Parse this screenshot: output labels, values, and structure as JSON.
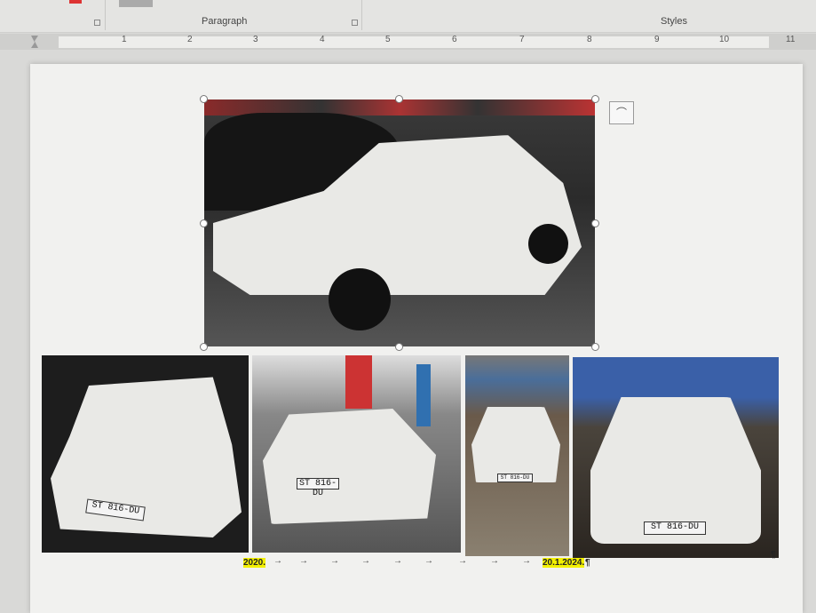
{
  "ribbon": {
    "groups": {
      "paragraph": "Paragraph",
      "styles": "Styles"
    }
  },
  "ruler": {
    "marks": [
      "1",
      "2",
      "3",
      "4",
      "5",
      "6",
      "7",
      "8",
      "9",
      "10",
      "11"
    ]
  },
  "document": {
    "photos": [
      {
        "name": "main-photo",
        "plate": ""
      },
      {
        "name": "front-photo-1",
        "plate": "ST 816-DU"
      },
      {
        "name": "rear-photo",
        "plate": "ST 816-DU"
      },
      {
        "name": "front-photo-2",
        "plate": "ST 816-DU"
      },
      {
        "name": "front-photo-3",
        "plate": "ST 816-DU"
      }
    ],
    "caption_left": "2020.",
    "caption_right": "20.1.2024.",
    "pilcrow": "¶",
    "tab_arrow": "→"
  }
}
